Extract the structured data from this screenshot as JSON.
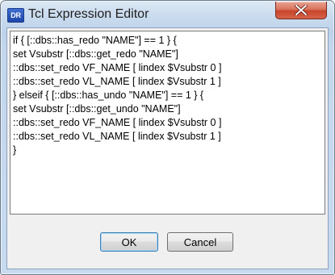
{
  "window": {
    "title": "Tcl Expression Editor",
    "icon_text": "DR"
  },
  "editor": {
    "lines": [
      "if { [::dbs::has_redo \"NAME\"] == 1 } {",
      "set Vsubstr [::dbs::get_redo \"NAME\"]",
      "::dbs::set_redo VF_NAME [ lindex $Vsubstr 0 ]",
      "::dbs::set_redo VL_NAME [ lindex $Vsubstr 1 ]",
      "} elseif { [::dbs::has_undo \"NAME\"] == 1 } {",
      "set Vsubstr [::dbs::get_undo \"NAME\"]",
      "::dbs::set_redo VF_NAME [ lindex $Vsubstr 0 ]",
      "::dbs::set_redo VL_NAME [ lindex $Vsubstr 1 ]",
      "}"
    ]
  },
  "buttons": {
    "ok_label": "OK",
    "cancel_label": "Cancel"
  },
  "colors": {
    "close_button": "#c8452b",
    "title_bar": "#c4d7ec",
    "dialog_body": "#f0f0f0"
  },
  "icons": {
    "close": "close-icon",
    "app": "app-icon"
  }
}
